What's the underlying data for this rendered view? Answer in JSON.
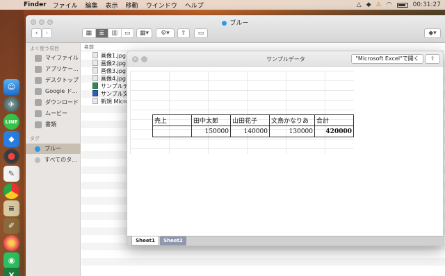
{
  "menubar": {
    "app_name": "Finder",
    "menus": [
      "ファイル",
      "編集",
      "表示",
      "移動",
      "ウインドウ",
      "ヘルプ"
    ],
    "clock": "00:31:27"
  },
  "finder": {
    "title": "ブルー",
    "sidebar": {
      "favorites_header": "よく使う項目",
      "favorites": [
        {
          "label": "マイファイル",
          "icon": "my-files-icon"
        },
        {
          "label": "アプリケー...",
          "icon": "applications-icon"
        },
        {
          "label": "デスクトップ",
          "icon": "desktop-icon"
        },
        {
          "label": "Google ド...",
          "icon": "google-drive-icon"
        },
        {
          "label": "ダウンロード",
          "icon": "downloads-icon"
        },
        {
          "label": "ムービー",
          "icon": "movies-icon"
        },
        {
          "label": "書類",
          "icon": "documents-icon"
        }
      ],
      "tags_header": "タグ",
      "tags": [
        {
          "label": "ブルー",
          "color": "#2a9be8"
        },
        {
          "label": "すべてのタ...",
          "color": "#bdbdbd"
        }
      ]
    },
    "list": {
      "column_name": "名前",
      "files": [
        {
          "name": "画像1.jpg",
          "type": "image"
        },
        {
          "name": "画像2.jpg",
          "type": "image"
        },
        {
          "name": "画像3.jpg",
          "type": "image"
        },
        {
          "name": "画像4.jpg",
          "type": "image"
        },
        {
          "name": "サンプルデ",
          "type": "excel"
        },
        {
          "name": "サンプル文",
          "type": "word"
        },
        {
          "name": "新規 Micro",
          "type": "doc"
        }
      ]
    }
  },
  "quicklook": {
    "title": "サンプルデータ",
    "open_button": "\"Microsoft Excel\"で開く",
    "table": {
      "headers": [
        "売上",
        "田中太郎",
        "山田花子",
        "文鳥かなりあ",
        "合計"
      ],
      "values": [
        "",
        "150000",
        "140000",
        "130000",
        "420000"
      ]
    },
    "sheets": [
      "Sheet1",
      "Sheet2"
    ]
  }
}
